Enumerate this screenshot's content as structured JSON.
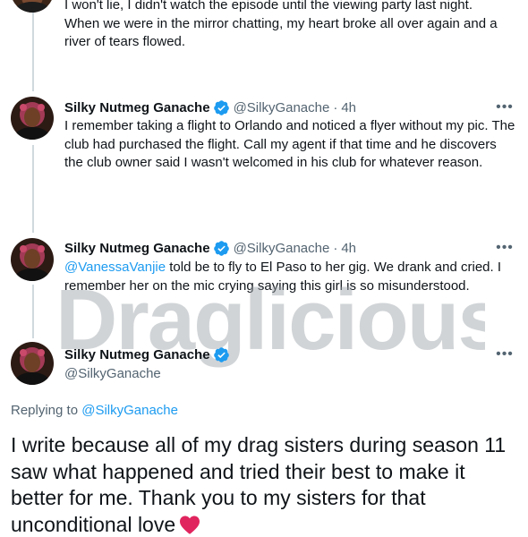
{
  "prev_tweet": {
    "text_line1": "I won't lie, I didn't watch the episode until the viewing party last night.",
    "text_line2": "When we were in the mirror chatting, my heart broke all over again and a",
    "text_line3": "river of tears flowed."
  },
  "tweets": [
    {
      "display_name": "Silky Nutmeg Ganache",
      "handle": "@SilkyGanache",
      "separator": "·",
      "time": "4h",
      "text": "I remember taking a flight to Orlando and noticed a flyer without my pic. The club had purchased the flight. Call my agent if that time and he discovers  the club owner said I wasn't welcomed in his club for whatever reason."
    },
    {
      "display_name": "Silky Nutmeg Ganache",
      "handle": "@SilkyGanache",
      "separator": "·",
      "time": "4h",
      "mention": "@VanessaVanjie",
      "text": " told be to fly to El Paso to her gig. We drank and cried. I remember her on the mic crying saying this girl is so misunderstood."
    }
  ],
  "main_tweet": {
    "display_name": "Silky Nutmeg Ganache",
    "handle": "@SilkyGanache",
    "replying_prefix": "Replying to ",
    "replying_handle": "@SilkyGanache",
    "text": "I write because all of my drag sisters during season 11 saw what happened and tried their best to make it better for me. Thank you to my sisters for that unconditional love"
  },
  "more_label": "•••",
  "watermark_text": "Draglicious",
  "icons": {
    "verified": "verified-badge-icon",
    "more": "more-options-icon",
    "heart": "red-heart-emoji"
  },
  "colors": {
    "link": "#1d9bf0",
    "secondary": "#536471",
    "verified": "#1d9bf0",
    "heart": "#e0245e"
  }
}
